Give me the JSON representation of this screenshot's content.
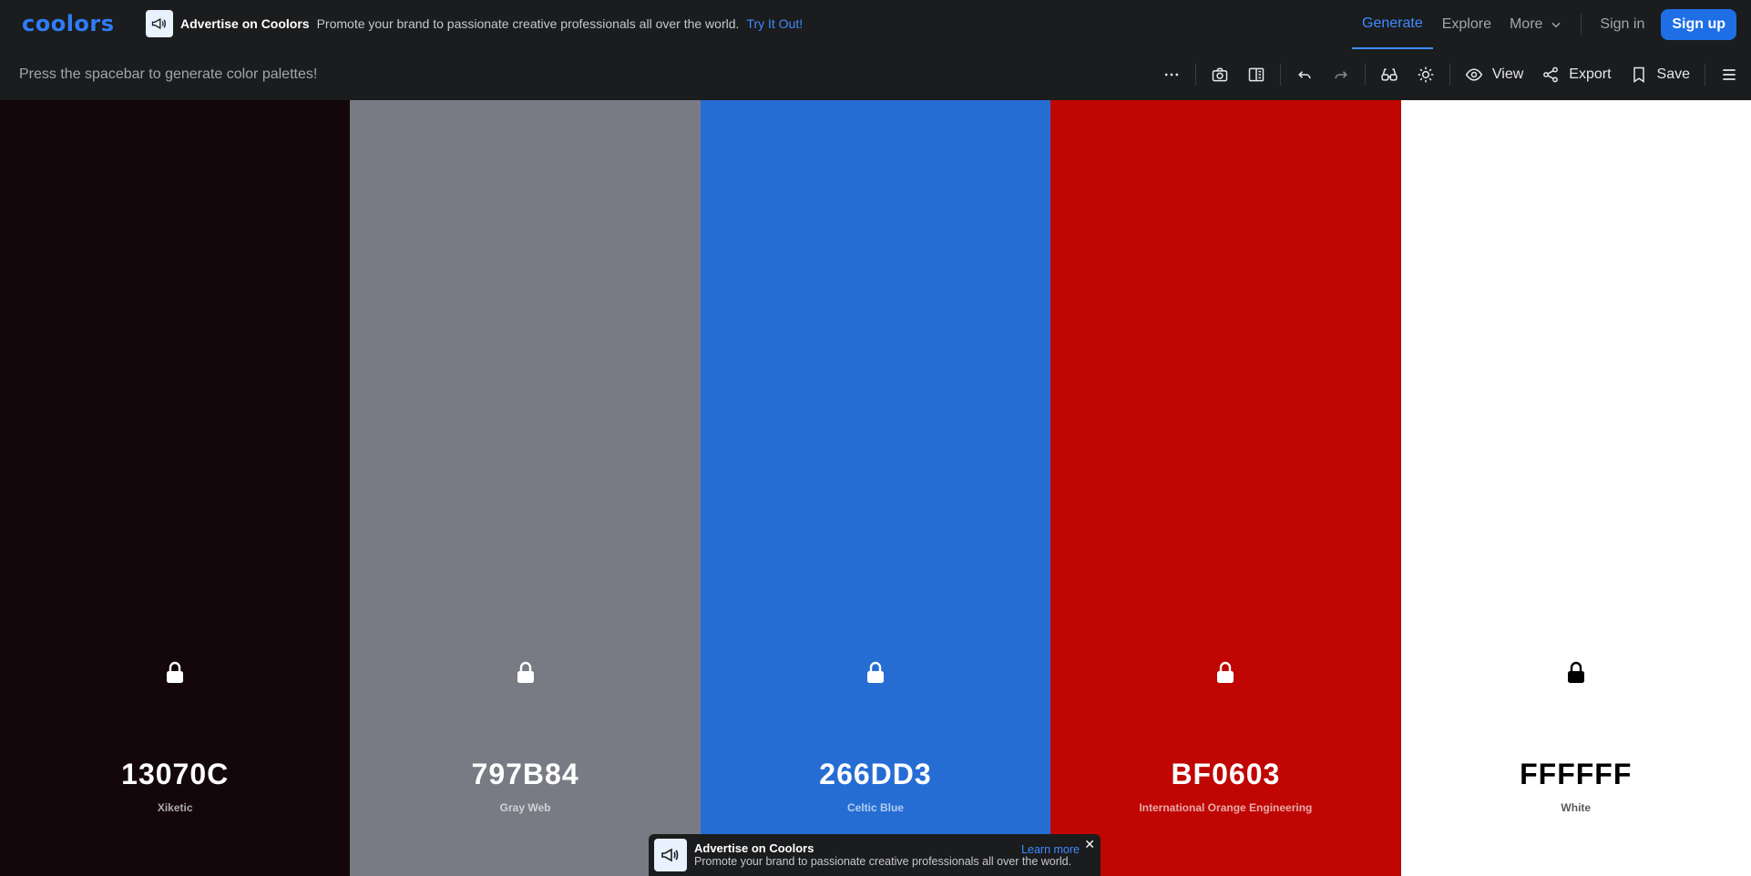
{
  "app": {
    "logo": "coolors"
  },
  "top_ad": {
    "title": "Advertise on Coolors",
    "text": "Promote your brand to passionate creative professionals all over the world.",
    "link": "Try It Out!"
  },
  "nav": {
    "generate": "Generate",
    "explore": "Explore",
    "more": "More",
    "signin": "Sign in",
    "signup": "Sign up"
  },
  "toolbar": {
    "hint": "Press the spacebar to generate color palettes!",
    "view_label": "View",
    "export_label": "Export",
    "save_label": "Save",
    "icons": [
      "more-icon",
      "camera-icon",
      "panel-icon",
      "undo-icon",
      "redo-icon",
      "glasses-icon",
      "sun-icon",
      "eye-icon",
      "share-icon",
      "bookmark-icon",
      "menu-icon"
    ]
  },
  "palette": [
    {
      "hex": "13070C",
      "name": "Xiketic",
      "color": "#13070C",
      "text_color": "#ffffff",
      "locked": false
    },
    {
      "hex": "797B84",
      "name": "Gray Web",
      "color": "#797B84",
      "text_color": "#ffffff",
      "locked": false
    },
    {
      "hex": "266DD3",
      "name": "Celtic Blue",
      "color": "#266DD3",
      "text_color": "#ffffff",
      "locked": false
    },
    {
      "hex": "BF0603",
      "name": "International Orange Engineering",
      "color": "#BF0603",
      "text_color": "#ffffff",
      "locked": false
    },
    {
      "hex": "FFFFFF",
      "name": "White",
      "color": "#FFFFFF",
      "text_color": "#000000",
      "locked": false
    }
  ],
  "bottom_ad": {
    "title": "Advertise on Coolors",
    "text": "Promote your brand to passionate creative professionals all over the world.",
    "link": "Learn more",
    "close": "✕"
  }
}
